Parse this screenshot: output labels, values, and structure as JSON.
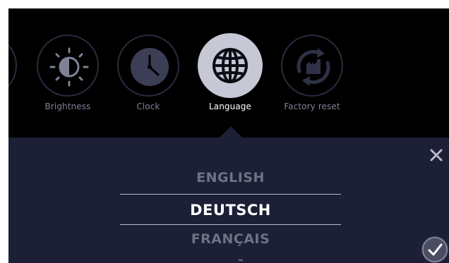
{
  "settings_menu": {
    "items": [
      {
        "label": "",
        "icon": "partial-item-icon",
        "active": false
      },
      {
        "label": "Brightness",
        "icon": "brightness-icon",
        "active": false
      },
      {
        "label": "Clock",
        "icon": "clock-icon",
        "active": false
      },
      {
        "label": "Language",
        "icon": "globe-icon",
        "active": true
      },
      {
        "label": "Factory reset",
        "icon": "factory-reset-icon",
        "active": false
      }
    ]
  },
  "language_picker": {
    "options": [
      "ENGLISH",
      "DEUTSCH",
      "FRANÇAIS"
    ],
    "selected": "DEUTSCH"
  },
  "colors": {
    "background": "#000000",
    "panel": "#1c1f35",
    "active_circle": "#c7c8d6",
    "label_inactive": "#7f8196",
    "label_active": "#ffffff"
  }
}
